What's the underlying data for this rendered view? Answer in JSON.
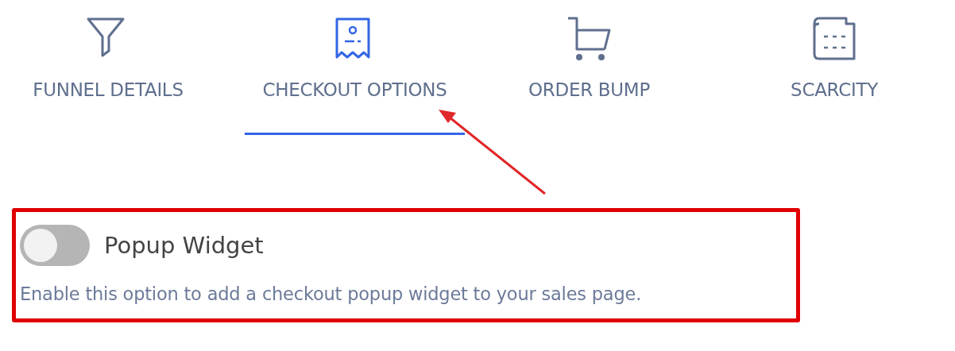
{
  "tabs": [
    {
      "label": "FUNNEL DETAILS",
      "kind": "funnel",
      "selected": false
    },
    {
      "label": "CHECKOUT OPTIONS",
      "kind": "receipt",
      "selected": true
    },
    {
      "label": "ORDER BUMP",
      "kind": "cart",
      "selected": false
    },
    {
      "label": "SCARCITY",
      "kind": "calendar",
      "selected": false
    }
  ],
  "option": {
    "title": "Popup Widget",
    "on": false,
    "description": "Enable this option to add a checkout popup widget to your sales page."
  }
}
